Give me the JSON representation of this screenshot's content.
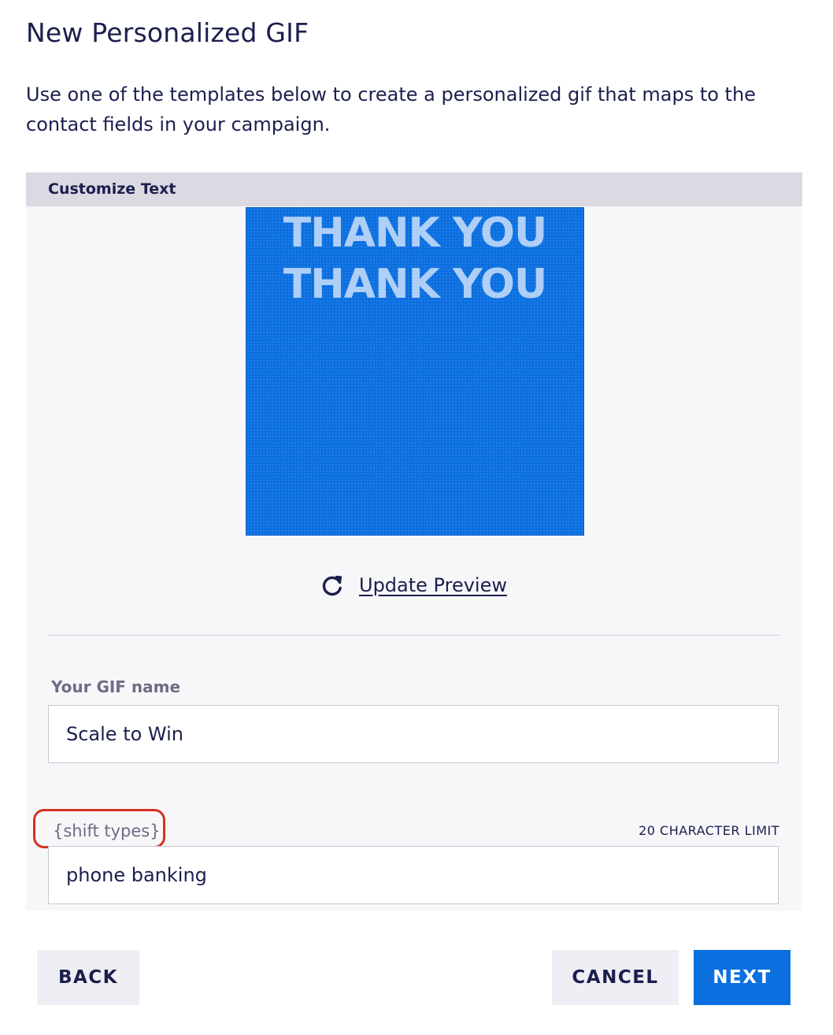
{
  "page": {
    "title": "New Personalized GIF",
    "description": "Use one of the templates below to create a personalized gif that maps to the contact fields in your campaign."
  },
  "panel": {
    "header": "Customize Text",
    "gif_preview": {
      "line_1": "THANK YOU",
      "line_2": "THANK YOU"
    },
    "update_preview": {
      "icon": "refresh-icon",
      "label": "Update Preview"
    },
    "gif_name": {
      "label": "Your GIF name",
      "value": "Scale to Win"
    },
    "shift_types": {
      "label": "{shift types}",
      "limit": "20 CHARACTER LIMIT",
      "value": "phone banking"
    }
  },
  "footer": {
    "back_label": "BACK",
    "cancel_label": "CANCEL",
    "next_label": "NEXT"
  },
  "colors": {
    "text": "#1b1f4d",
    "accent": "#0b6fe0",
    "panel_bg": "#f7f7fa",
    "header_bg": "#dbdae3",
    "highlight": "#d6321f"
  }
}
